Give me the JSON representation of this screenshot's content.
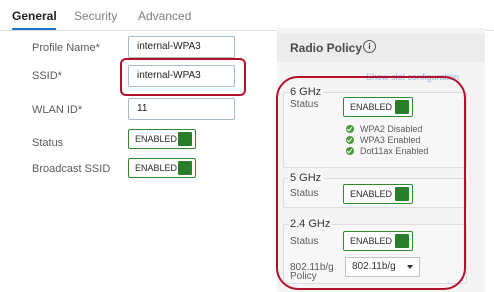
{
  "tabs": [
    "General",
    "Security",
    "Advanced"
  ],
  "form": {
    "profile_name_label": "Profile Name*",
    "profile_name_value": "internal-WPA3",
    "ssid_label": "SSID*",
    "ssid_value": "internal-WPA3",
    "wlan_id_label": "WLAN ID*",
    "wlan_id_value": "11",
    "status_label": "Status",
    "status_value": "ENABLED",
    "broadcast_label": "Broadcast SSID",
    "broadcast_value": "ENABLED"
  },
  "radio_policy": {
    "title": "Radio Policy",
    "info_glyph": "i",
    "show_link": "Show slot configuration",
    "band_6": {
      "title": "6 GHz",
      "status_label": "Status",
      "status_value": "ENABLED",
      "checks": [
        "WPA2 Disabled",
        "WPA3 Enabled",
        "Dot11ax Enabled"
      ]
    },
    "band_5": {
      "title": "5 GHz",
      "status_label": "Status",
      "status_value": "ENABLED"
    },
    "band_24": {
      "title": "2.4 GHz",
      "status_label": "Status",
      "status_value": "ENABLED",
      "policy_label_line1": "802.11b/g",
      "policy_label_line2": "Policy",
      "policy_value": "802.11b/g"
    }
  },
  "colors": {
    "highlight": "#b3102b",
    "enabled_green": "#2a7d2a",
    "tab_accent": "#1b74c5"
  }
}
